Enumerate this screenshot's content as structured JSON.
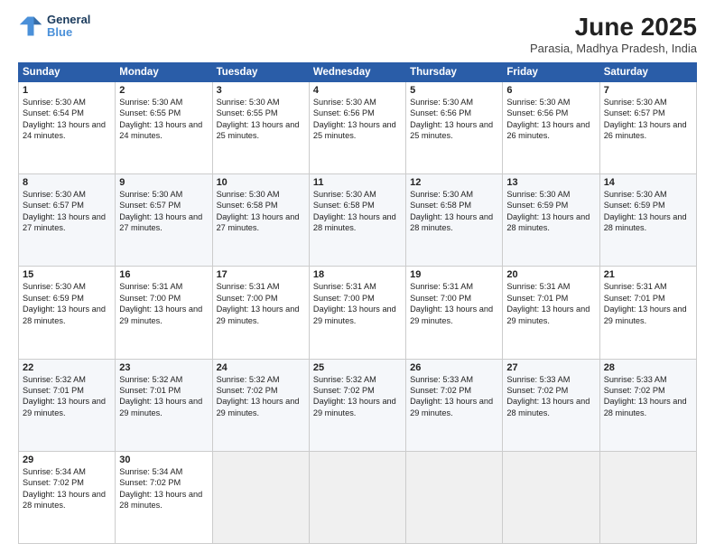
{
  "logo": {
    "line1": "General",
    "line2": "Blue"
  },
  "title": "June 2025",
  "location": "Parasia, Madhya Pradesh, India",
  "days_header": [
    "Sunday",
    "Monday",
    "Tuesday",
    "Wednesday",
    "Thursday",
    "Friday",
    "Saturday"
  ],
  "weeks": [
    [
      {
        "num": "1",
        "rise": "5:30 AM",
        "set": "6:54 PM",
        "daylight": "13 hours and 24 minutes."
      },
      {
        "num": "2",
        "rise": "5:30 AM",
        "set": "6:55 PM",
        "daylight": "13 hours and 24 minutes."
      },
      {
        "num": "3",
        "rise": "5:30 AM",
        "set": "6:55 PM",
        "daylight": "13 hours and 25 minutes."
      },
      {
        "num": "4",
        "rise": "5:30 AM",
        "set": "6:56 PM",
        "daylight": "13 hours and 25 minutes."
      },
      {
        "num": "5",
        "rise": "5:30 AM",
        "set": "6:56 PM",
        "daylight": "13 hours and 25 minutes."
      },
      {
        "num": "6",
        "rise": "5:30 AM",
        "set": "6:56 PM",
        "daylight": "13 hours and 26 minutes."
      },
      {
        "num": "7",
        "rise": "5:30 AM",
        "set": "6:57 PM",
        "daylight": "13 hours and 26 minutes."
      }
    ],
    [
      {
        "num": "8",
        "rise": "5:30 AM",
        "set": "6:57 PM",
        "daylight": "13 hours and 27 minutes."
      },
      {
        "num": "9",
        "rise": "5:30 AM",
        "set": "6:57 PM",
        "daylight": "13 hours and 27 minutes."
      },
      {
        "num": "10",
        "rise": "5:30 AM",
        "set": "6:58 PM",
        "daylight": "13 hours and 27 minutes."
      },
      {
        "num": "11",
        "rise": "5:30 AM",
        "set": "6:58 PM",
        "daylight": "13 hours and 28 minutes."
      },
      {
        "num": "12",
        "rise": "5:30 AM",
        "set": "6:58 PM",
        "daylight": "13 hours and 28 minutes."
      },
      {
        "num": "13",
        "rise": "5:30 AM",
        "set": "6:59 PM",
        "daylight": "13 hours and 28 minutes."
      },
      {
        "num": "14",
        "rise": "5:30 AM",
        "set": "6:59 PM",
        "daylight": "13 hours and 28 minutes."
      }
    ],
    [
      {
        "num": "15",
        "rise": "5:30 AM",
        "set": "6:59 PM",
        "daylight": "13 hours and 28 minutes."
      },
      {
        "num": "16",
        "rise": "5:31 AM",
        "set": "7:00 PM",
        "daylight": "13 hours and 29 minutes."
      },
      {
        "num": "17",
        "rise": "5:31 AM",
        "set": "7:00 PM",
        "daylight": "13 hours and 29 minutes."
      },
      {
        "num": "18",
        "rise": "5:31 AM",
        "set": "7:00 PM",
        "daylight": "13 hours and 29 minutes."
      },
      {
        "num": "19",
        "rise": "5:31 AM",
        "set": "7:00 PM",
        "daylight": "13 hours and 29 minutes."
      },
      {
        "num": "20",
        "rise": "5:31 AM",
        "set": "7:01 PM",
        "daylight": "13 hours and 29 minutes."
      },
      {
        "num": "21",
        "rise": "5:31 AM",
        "set": "7:01 PM",
        "daylight": "13 hours and 29 minutes."
      }
    ],
    [
      {
        "num": "22",
        "rise": "5:32 AM",
        "set": "7:01 PM",
        "daylight": "13 hours and 29 minutes."
      },
      {
        "num": "23",
        "rise": "5:32 AM",
        "set": "7:01 PM",
        "daylight": "13 hours and 29 minutes."
      },
      {
        "num": "24",
        "rise": "5:32 AM",
        "set": "7:02 PM",
        "daylight": "13 hours and 29 minutes."
      },
      {
        "num": "25",
        "rise": "5:32 AM",
        "set": "7:02 PM",
        "daylight": "13 hours and 29 minutes."
      },
      {
        "num": "26",
        "rise": "5:33 AM",
        "set": "7:02 PM",
        "daylight": "13 hours and 29 minutes."
      },
      {
        "num": "27",
        "rise": "5:33 AM",
        "set": "7:02 PM",
        "daylight": "13 hours and 28 minutes."
      },
      {
        "num": "28",
        "rise": "5:33 AM",
        "set": "7:02 PM",
        "daylight": "13 hours and 28 minutes."
      }
    ],
    [
      {
        "num": "29",
        "rise": "5:34 AM",
        "set": "7:02 PM",
        "daylight": "13 hours and 28 minutes."
      },
      {
        "num": "30",
        "rise": "5:34 AM",
        "set": "7:02 PM",
        "daylight": "13 hours and 28 minutes."
      },
      null,
      null,
      null,
      null,
      null
    ]
  ]
}
